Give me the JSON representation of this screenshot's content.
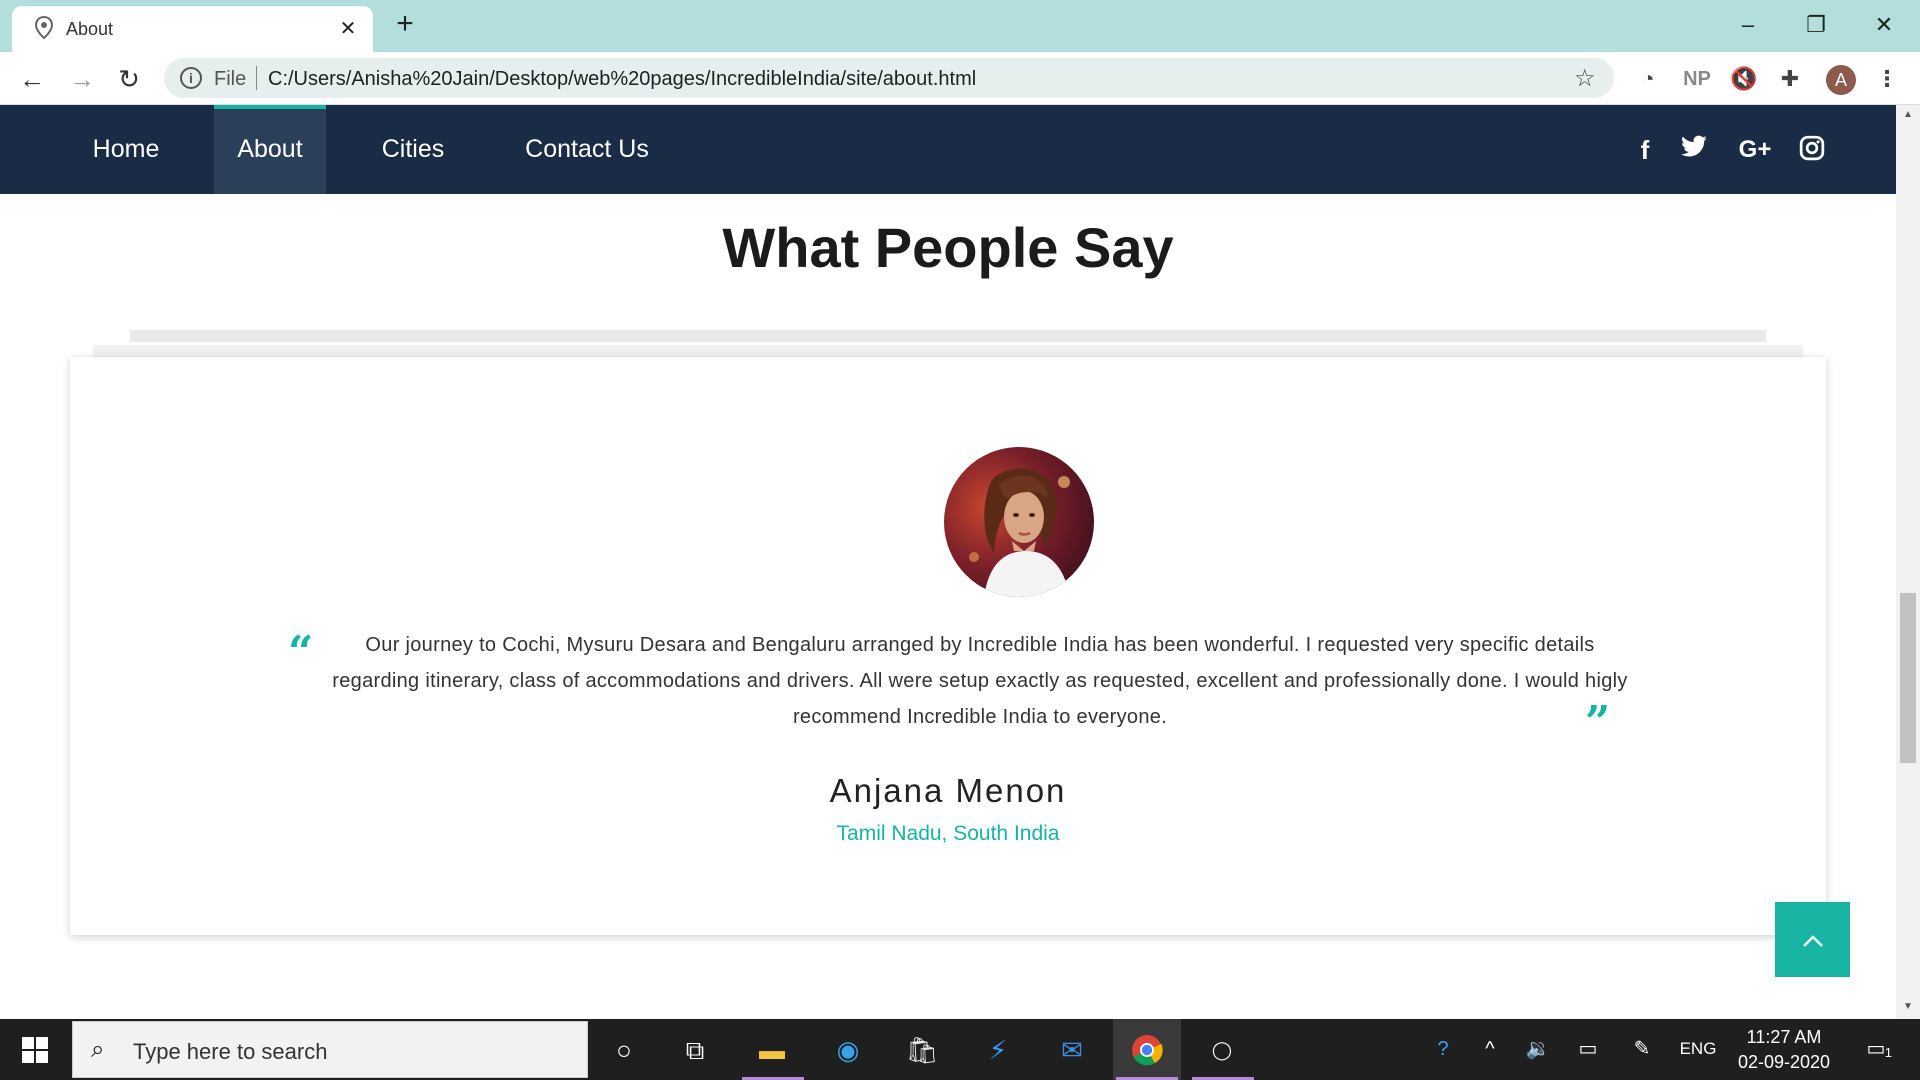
{
  "browser": {
    "tab_title": "About",
    "address_scheme": "File",
    "url": "C:/Users/Anisha%20Jain/Desktop/web%20pages/IncredibleIndia/site/about.html",
    "extension_np": "NP",
    "profile_initial": "A"
  },
  "site_nav": {
    "items": [
      {
        "label": "Home",
        "active": false
      },
      {
        "label": "About",
        "active": true
      },
      {
        "label": "Cities",
        "active": false
      },
      {
        "label": "Contact Us",
        "active": false
      }
    ],
    "social_icons": [
      "facebook-icon",
      "twitter-icon",
      "google-plus-icon",
      "instagram-icon"
    ],
    "social_glyphs": {
      "facebook": "f",
      "google_plus": "G+"
    }
  },
  "testimonials": {
    "title": "What People Say",
    "quote_open": "“",
    "quote_close": "”",
    "text": "Our journey to Cochi, Mysuru Desara and Bengaluru arranged by Incredible India has been wonderful. I requested very specific details regarding itinerary, class of accommodations and drivers. All were setup exactly as requested, excellent and professionally done. I would higly recommend Incredible India to everyone.",
    "name": "Anjana Menon",
    "location": "Tamil Nadu, South India"
  },
  "taskbar": {
    "search_placeholder": "Type here to search",
    "language": "ENG",
    "time": "11:27 AM",
    "date": "02-09-2020",
    "notification_count": "1"
  },
  "colors": {
    "nav_bg": "#1a2c45",
    "accent": "#17b3a3",
    "tabstrip": "#b2dfdb"
  }
}
